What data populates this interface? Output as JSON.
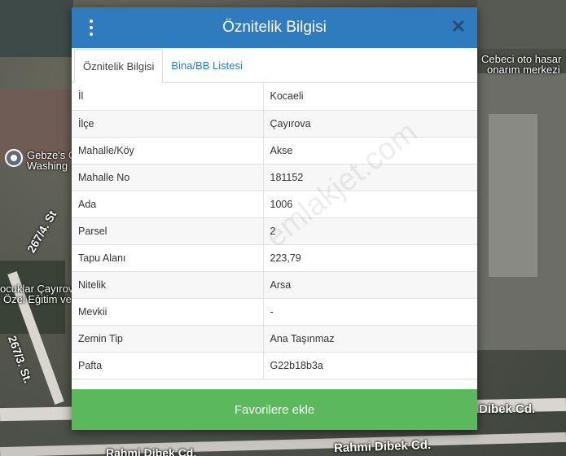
{
  "map": {
    "labels": {
      "poi_right_1": "Cebeci oto hasar",
      "poi_right_2": "onarım merkezi",
      "poi_left_1": "Gebze's C",
      "poi_left_2": "Washing",
      "street_1": "267/4. St",
      "poi_school_1": "ocuklar Çayırov",
      "poi_school_2": "Özel Eğitim ve",
      "street_2": "267/3. St.",
      "street_3": "Dibek Cd.",
      "street_4": "Rahmi Dibek Cd.",
      "street_5": "Rahmi Dibek Cd."
    }
  },
  "dialog": {
    "title": "Öznitelik Bilgisi",
    "tabs": [
      {
        "label": "Öznitelik Bilgisi",
        "active": true
      },
      {
        "label": "Bina/BB Listesi",
        "active": false
      }
    ],
    "rows": [
      {
        "key": "İl",
        "value": "Kocaeli"
      },
      {
        "key": "İlçe",
        "value": "Çayırova"
      },
      {
        "key": "Mahalle/Köy",
        "value": "Akse"
      },
      {
        "key": "Mahalle No",
        "value": "181152"
      },
      {
        "key": "Ada",
        "value": "1006"
      },
      {
        "key": "Parsel",
        "value": "2"
      },
      {
        "key": "Tapu Alanı",
        "value": "223,79"
      },
      {
        "key": "Nitelik",
        "value": "Arsa"
      },
      {
        "key": "Mevkii",
        "value": "-"
      },
      {
        "key": "Zemin Tip",
        "value": "Ana Taşınmaz"
      },
      {
        "key": "Pafta",
        "value": "G22b18b3a"
      }
    ],
    "favorite_button": "Favorilere ekle",
    "watermark": "emlakjet.com"
  },
  "colors": {
    "header": "#2f7bbd",
    "button": "#5cb85c"
  },
  "icons": {
    "menu": "vertical-dots-icon",
    "close": "close-icon"
  }
}
